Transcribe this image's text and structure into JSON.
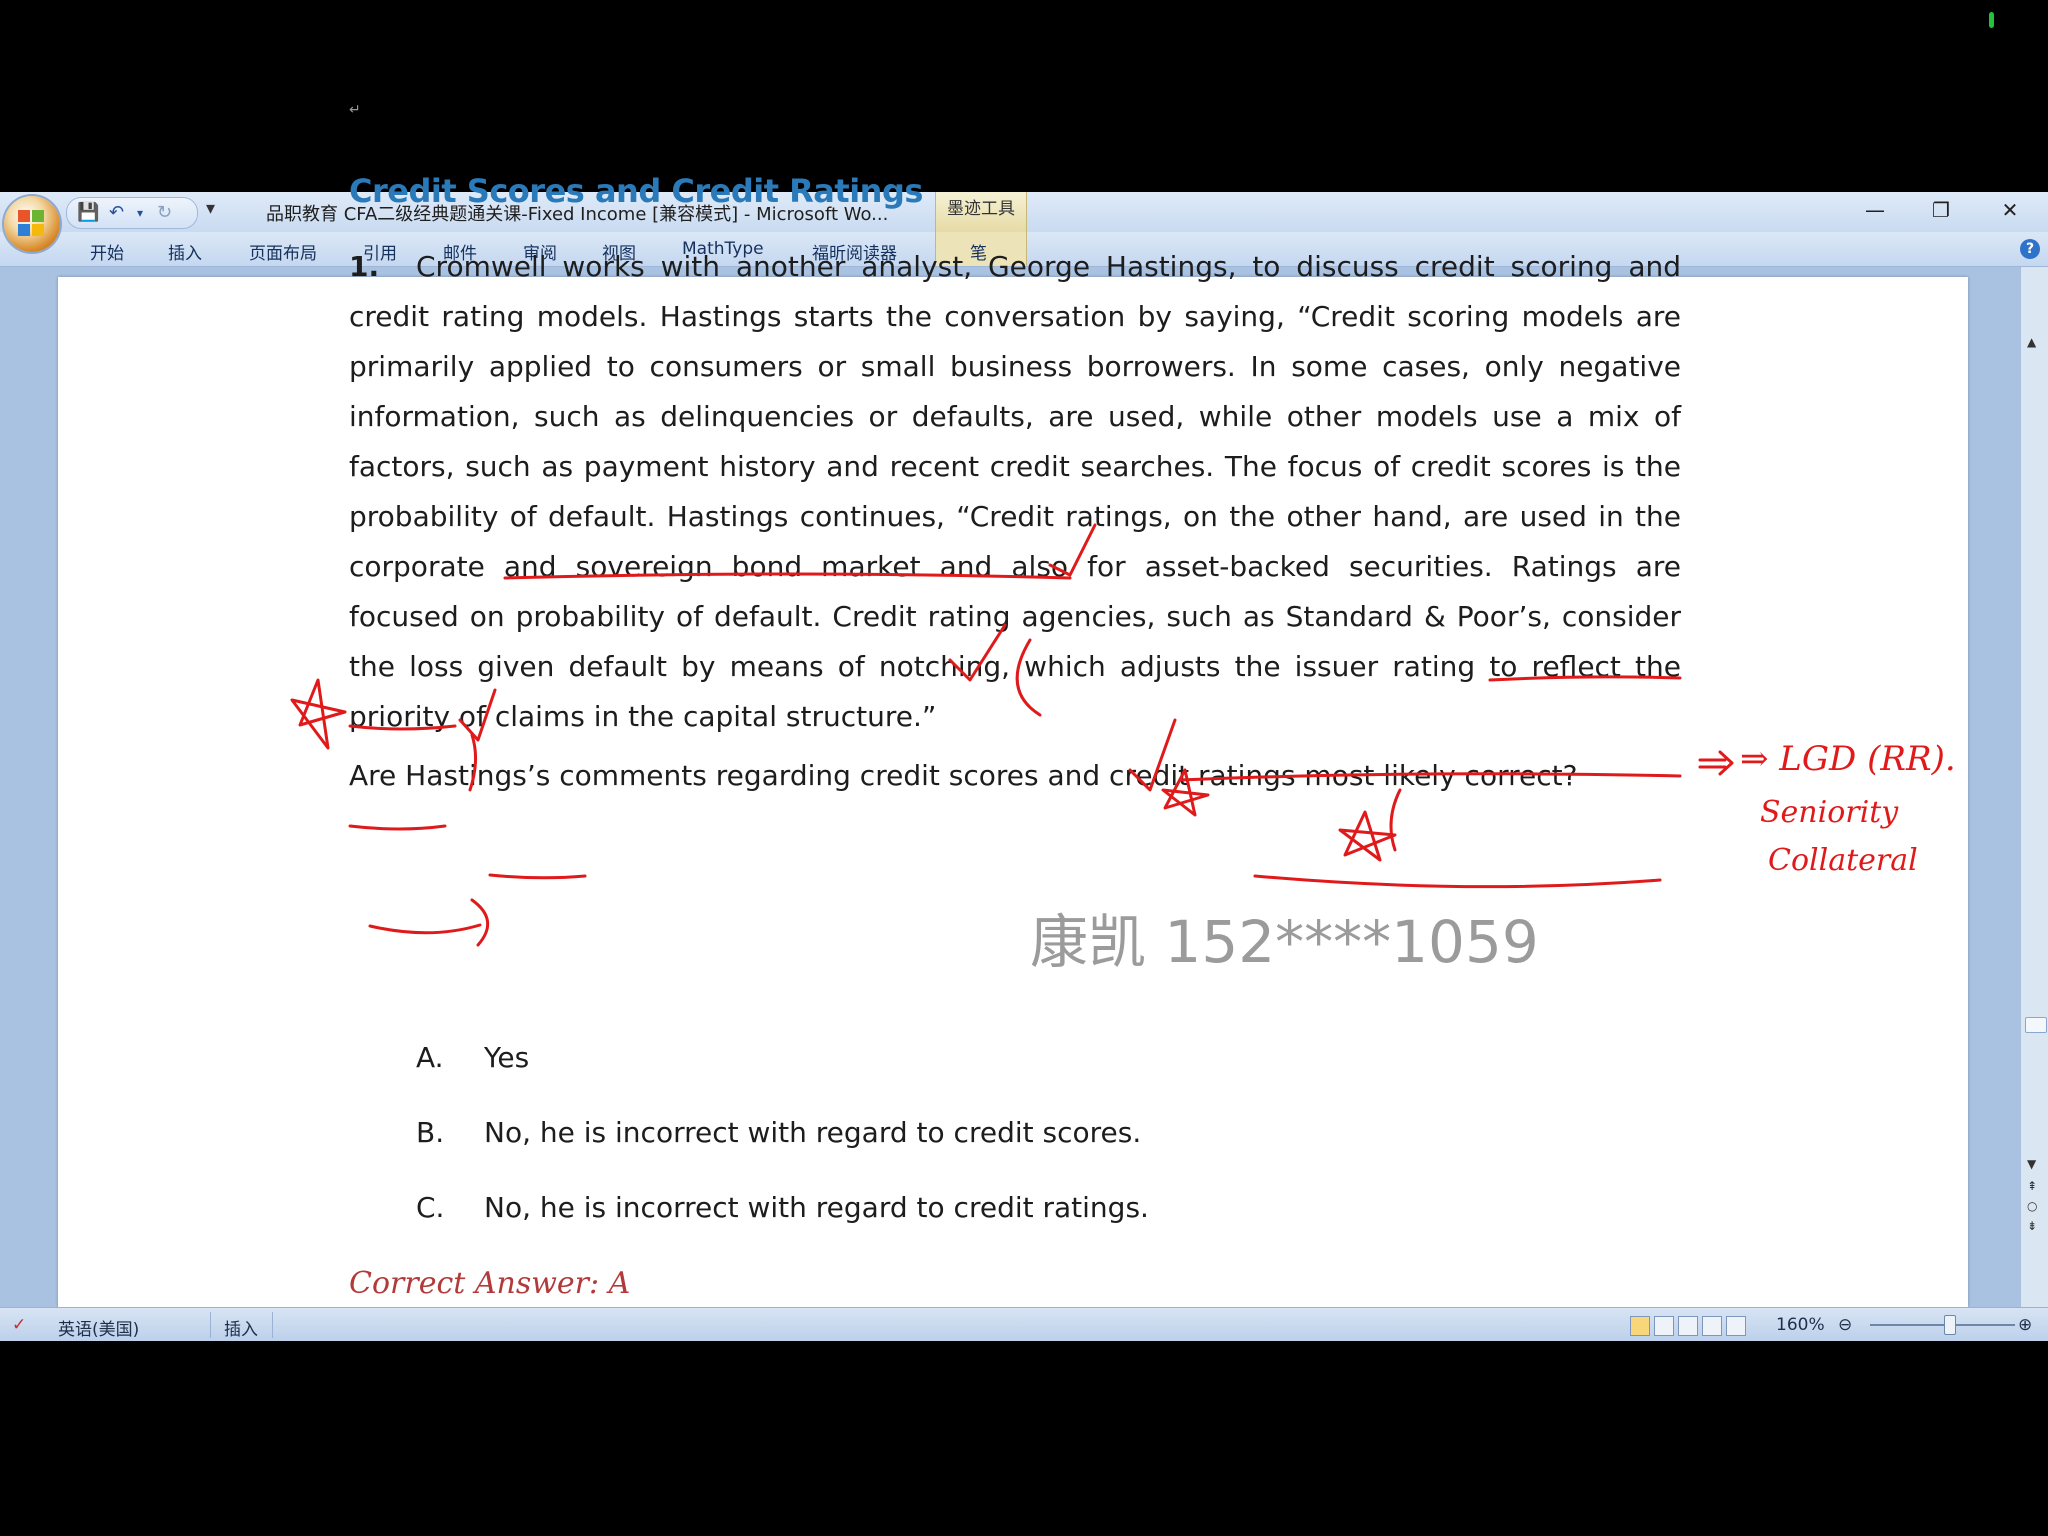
{
  "window": {
    "title": "品职教育 CFA二级经典题通关课-Fixed Income [兼容模式] - Microsoft Wo...",
    "ink_tools_tab": "墨迹工具",
    "controls": [
      "—",
      "❐",
      "✕"
    ]
  },
  "qat": [
    "💾",
    "↶",
    "▾",
    "↻"
  ],
  "ribbon_tabs": [
    "开始",
    "插入",
    "页面布局",
    "引用",
    "邮件",
    "审阅",
    "视图",
    "MathType",
    "福昕阅读器",
    "笔"
  ],
  "document": {
    "heading": "Credit Scores and Credit Ratings",
    "question_number": "1.",
    "paragraph": "Cromwell works with another analyst, George Hastings, to discuss credit scoring and credit rating models. Hastings starts the conversation by saying, “Credit scoring models are primarily applied to consumers or small business borrowers. In some cases, only negative information, such as delinquencies or defaults, are used, while other models use a mix of factors, such as payment history and recent credit searches. The focus of credit scores is the probability of default. Hastings continues, “Credit ratings, on the other hand, are used in the corporate and sovereign bond market and also for asset-backed securities. Ratings are focused on probability of default. Credit rating agencies, such as Standard & Poor’s, consider the loss given default by means of notching, which adjusts the issuer rating to reflect the priority of claims in the capital structure.”",
    "question": "Are Hastings’s comments regarding credit scores and credit ratings most likely correct?",
    "options": [
      {
        "label": "A.",
        "text": "Yes"
      },
      {
        "label": "B.",
        "text": "No, he is incorrect with regard to credit scores."
      },
      {
        "label": "C.",
        "text": "No, he is incorrect with regard to credit ratings."
      }
    ],
    "answer": "Correct Answer: A"
  },
  "handwriting": {
    "line1": "⇒ LGD (RR).",
    "line2": "Seniority",
    "line3": "Collateral"
  },
  "watermark": "康凯 152****1059",
  "status_bar": {
    "language": "英语(美国)",
    "mode": "插入",
    "zoom": "160%"
  },
  "colors": {
    "heading": "#2a79b8",
    "ink": "#e01a1a",
    "answer": "#b23a3a"
  }
}
